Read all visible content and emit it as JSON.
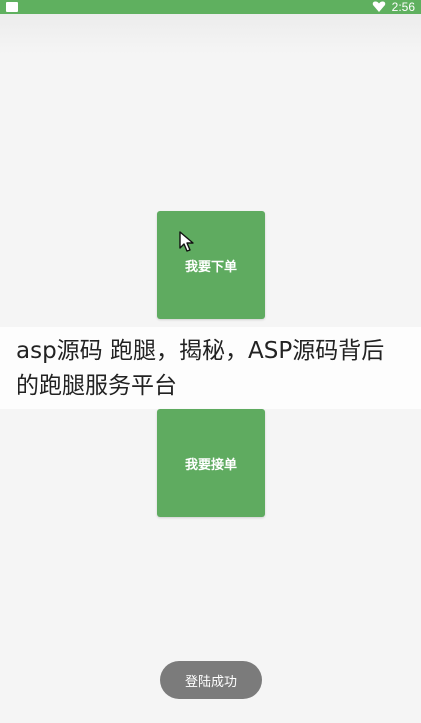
{
  "status_bar": {
    "time": "2:56",
    "left_icon": "notification-square-icon",
    "right_icon": "signal-heart-icon",
    "color": "#5fb05f"
  },
  "buttons": {
    "order_label": "我要下单",
    "accept_label": "我要接单",
    "color": "#5fab60"
  },
  "caption": {
    "text": "asp源码 跑腿，揭秘，ASP源码背后的跑腿服务平台"
  },
  "toast": {
    "text": "登陆成功"
  }
}
